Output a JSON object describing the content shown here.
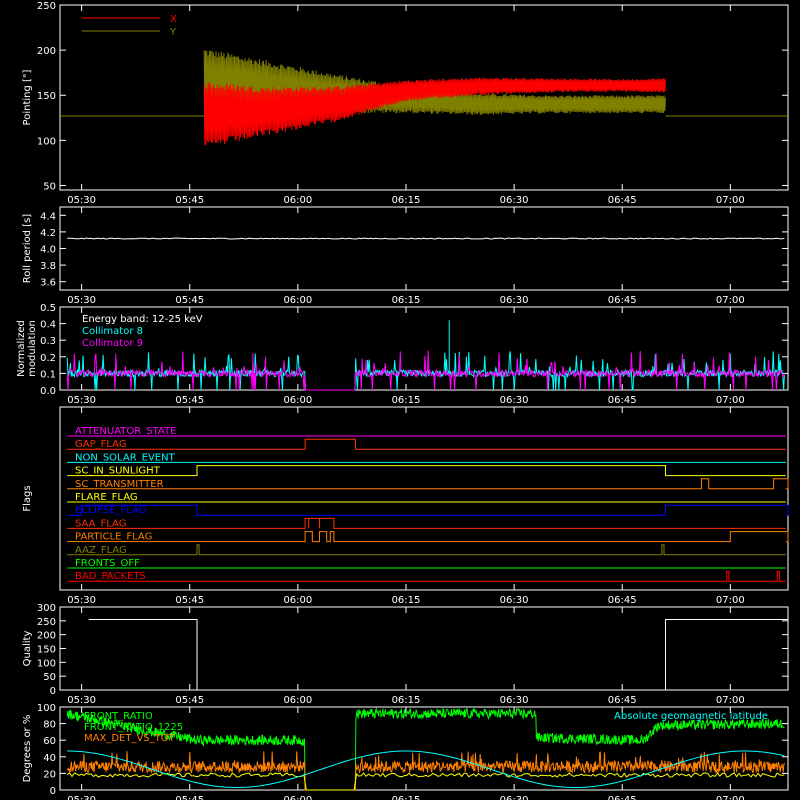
{
  "time_ticks": [
    "05:30",
    "05:45",
    "06:00",
    "06:15",
    "06:30",
    "06:45",
    "07:00"
  ],
  "chart_data": [
    {
      "type": "line",
      "ylabel": "Pointing [\"]",
      "ylim": [
        45,
        250
      ],
      "yticks": [
        "250",
        "200",
        "150",
        "100",
        "50"
      ],
      "legend": [
        {
          "name": "X",
          "color": "#ff0000"
        },
        {
          "name": "Y",
          "color": "#808000"
        }
      ],
      "x_range": [
        "05:47",
        "06:51"
      ],
      "series": [
        {
          "name": "X",
          "color": "#ff0000",
          "x": [
            "05:47",
            "05:55",
            "06:05",
            "06:15",
            "06:25",
            "06:35",
            "06:45",
            "06:51"
          ],
          "center": [
            128,
            132,
            140,
            155,
            160,
            161,
            161,
            161
          ],
          "amplitude": [
            38,
            28,
            20,
            12,
            10,
            8,
            7,
            8
          ]
        },
        {
          "name": "Y",
          "color": "#808000",
          "x": [
            "05:47",
            "05:55",
            "06:05",
            "06:15",
            "06:25",
            "06:35",
            "06:45",
            "06:51"
          ],
          "center": [
            165,
            160,
            152,
            145,
            140,
            140,
            140,
            140
          ],
          "amplitude": [
            38,
            30,
            22,
            15,
            12,
            10,
            10,
            10
          ]
        }
      ],
      "baseline": 127
    },
    {
      "type": "line",
      "ylabel": "Roll period [s]",
      "ylim": [
        3.5,
        4.5
      ],
      "yticks": [
        "4.4",
        "4.2",
        "4.0",
        "3.8",
        "3.6"
      ],
      "series": [
        {
          "name": "",
          "color": "#ffffff",
          "value": 4.12
        }
      ]
    },
    {
      "type": "line",
      "ylabel": "Normalized modulation",
      "ylim": [
        0,
        0.5
      ],
      "yticks": [
        "0.5",
        "0.4",
        "0.3",
        "0.2",
        "0.1",
        "0.0"
      ],
      "annotation": "Energy band: 12-25 keV",
      "series": [
        {
          "name": "Collimator 8",
          "color": "#00ffff"
        },
        {
          "name": "Collimator 9",
          "color": "#ff00ff"
        }
      ],
      "gap": [
        "06:01",
        "06:08"
      ],
      "spike": {
        "x": "06:21",
        "y": 0.42
      }
    },
    {
      "type": "line",
      "ylabel": "Flags",
      "flags": [
        {
          "name": "ATTENUATOR_STATE",
          "color": "#ff00ff",
          "high": []
        },
        {
          "name": "GAP_FLAG",
          "color": "#ff3000",
          "high": [
            [
              "06:01",
              "06:08"
            ]
          ]
        },
        {
          "name": "NON_SOLAR_EVENT",
          "color": "#00ffff",
          "high": []
        },
        {
          "name": "SC_IN_SUNLIGHT",
          "color": "#ffff00",
          "high": [
            [
              "05:46",
              "06:51"
            ]
          ]
        },
        {
          "name": "SC_TRANSMITTER",
          "color": "#ff8000",
          "high": [
            [
              "06:56",
              "06:57"
            ],
            [
              "07:06",
              "07:08"
            ]
          ]
        },
        {
          "name": "FLARE_FLAG",
          "color": "#ffff00",
          "high": []
        },
        {
          "name": "ECLIPSE_FLAG",
          "color": "#0000ff",
          "high": [
            [
              "05:30",
              "05:46"
            ],
            [
              "06:51",
              "07:08"
            ]
          ]
        },
        {
          "name": "SAA_FLAG",
          "color": "#ff3000",
          "high": [
            [
              "06:01",
              "06:01.5"
            ],
            [
              "06:01.5",
              "06:03"
            ],
            [
              "06:03",
              "06:05"
            ]
          ]
        },
        {
          "name": "PARTICLE_FLAG",
          "color": "#ff8000",
          "high": [
            [
              "06:01",
              "06:02"
            ],
            [
              "06:03",
              "06:04"
            ],
            [
              "06:04.5",
              "06:05"
            ],
            [
              "07:00",
              "07:08"
            ]
          ]
        },
        {
          "name": "AAZ_FLAG",
          "color": "#808000",
          "high": [
            [
              "05:46",
              "05:46.3"
            ],
            [
              "06:50.5",
              "06:50.8"
            ]
          ]
        },
        {
          "name": "FRONTS_OFF",
          "color": "#00ff00",
          "high": []
        },
        {
          "name": "BAD_PACKETS",
          "color": "#ff0000",
          "high": [
            [
              "06:59.5",
              "06:59.8"
            ],
            [
              "07:06.5",
              "07:06.8"
            ]
          ]
        }
      ]
    },
    {
      "type": "line",
      "ylabel": "Quality",
      "ylim": [
        0,
        300
      ],
      "yticks": [
        "300",
        "250",
        "200",
        "150",
        "100",
        "50",
        "0"
      ],
      "series": [
        {
          "name": "",
          "color": "#ffffff",
          "x": [
            "05:30",
            "05:46",
            "05:46",
            "06:51",
            "06:51",
            "07:08"
          ],
          "y": [
            255,
            255,
            0,
            0,
            255,
            255
          ]
        }
      ]
    },
    {
      "type": "line",
      "ylabel": "Degrees or %",
      "ylim": [
        0,
        100
      ],
      "yticks": [
        "100",
        "80",
        "60",
        "40",
        "20",
        "0"
      ],
      "series": [
        {
          "name": "FRONT_RATIO",
          "color": "#00ff00"
        },
        {
          "name": "FRONT_RATIO_1225",
          "color": "#00ff00"
        },
        {
          "name": "MAX_DET_VS_TOT",
          "color": "#ff8000"
        },
        {
          "name": "Absolute geomagnetic latitude",
          "color": "#00ffff"
        }
      ]
    }
  ]
}
